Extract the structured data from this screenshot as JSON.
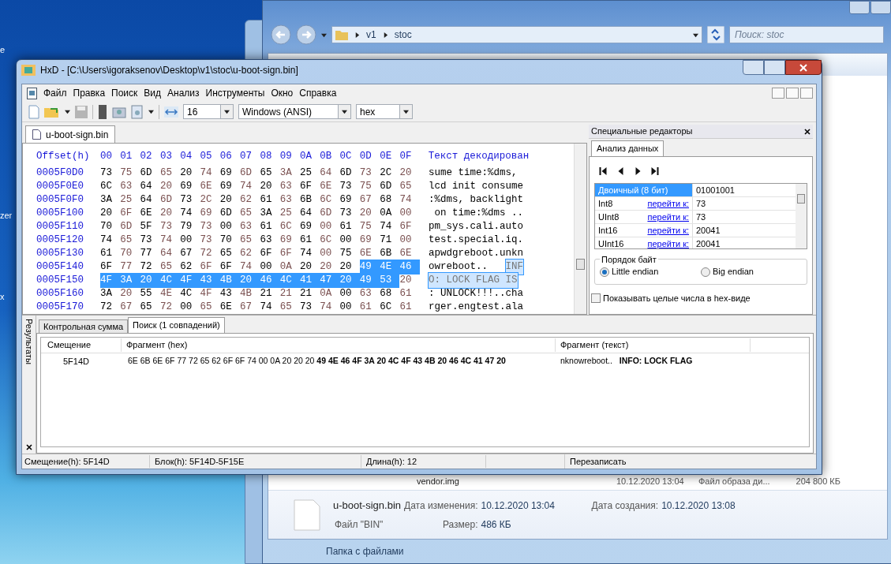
{
  "desktop": {
    "icon_labels": [
      "e",
      "zer",
      "x"
    ]
  },
  "explorer": {
    "breadcrumb": [
      "v1",
      "stoc"
    ],
    "search": {
      "placeholder": "Поиск: stoc"
    },
    "file_row": {
      "name": "vendor.img",
      "date": "10.12.2020 13:04",
      "type": "Файл образа ди...",
      "size": "204 800 КБ"
    },
    "details": {
      "name": "u-boot-sign.bin",
      "type": "Файл \"BIN\"",
      "modified_label": "Дата изменения:",
      "modified": "10.12.2020 13:04",
      "size_label": "Размер:",
      "size": "486 КБ",
      "created_label": "Дата создания:",
      "created": "10.12.2020 13:08"
    },
    "status": "Папка с файлами"
  },
  "hxd": {
    "title": "HxD - [C:\\Users\\igoraksenov\\Desktop\\v1\\stoc\\u-boot-sign.bin]",
    "menu": [
      "Файл",
      "Правка",
      "Поиск",
      "Вид",
      "Анализ",
      "Инструменты",
      "Окно",
      "Справка"
    ],
    "toolbar": {
      "bytes_per_row": "16",
      "charset": "Windows (ANSI)",
      "offset_base": "hex"
    },
    "document_tab": {
      "label": "u-boot-sign.bin",
      "selected": true
    },
    "hex_view": {
      "header": {
        "offset": "Offset(h)",
        "columns": [
          "00",
          "01",
          "02",
          "03",
          "04",
          "05",
          "06",
          "07",
          "08",
          "09",
          "0A",
          "0B",
          "0C",
          "0D",
          "0E",
          "0F"
        ],
        "text": "Текст декодирован"
      },
      "rows": [
        {
          "offset": "0005F0D0",
          "groups": [
            {
              "selected": false,
              "bytes": [
                "73",
                "75",
                "6D",
                "65",
                "20",
                "74",
                "69",
                "6D",
                "65",
                "3A",
                "25",
                "64",
                "6D",
                "73",
                "2C",
                "20"
              ]
            }
          ],
          "text": [
            {
              "selected": false,
              "text": "sume time:%dms,"
            }
          ]
        },
        {
          "offset": "0005F0E0",
          "groups": [
            {
              "selected": false,
              "bytes": [
                "6C",
                "63",
                "64",
                "20",
                "69",
                "6E",
                "69",
                "74",
                "20",
                "63",
                "6F",
                "6E",
                "73",
                "75",
                "6D",
                "65"
              ]
            }
          ],
          "text": [
            {
              "selected": false,
              "text": "lcd init consume"
            }
          ]
        },
        {
          "offset": "0005F0F0",
          "groups": [
            {
              "selected": false,
              "bytes": [
                "3A",
                "25",
                "64",
                "6D",
                "73",
                "2C",
                "20",
                "62",
                "61",
                "63",
                "6B",
                "6C",
                "69",
                "67",
                "68",
                "74"
              ]
            }
          ],
          "text": [
            {
              "selected": false,
              "text": ":%dms, backlight"
            }
          ]
        },
        {
          "offset": "0005F100",
          "groups": [
            {
              "selected": false,
              "bytes": [
                "20",
                "6F",
                "6E",
                "20",
                "74",
                "69",
                "6D",
                "65",
                "3A",
                "25",
                "64",
                "6D",
                "73",
                "20",
                "0A",
                "00"
              ]
            }
          ],
          "text": [
            {
              "selected": false,
              "text": " on time:%dms .."
            }
          ]
        },
        {
          "offset": "0005F110",
          "groups": [
            {
              "selected": false,
              "bytes": [
                "70",
                "6D",
                "5F",
                "73",
                "79",
                "73",
                "00",
                "63",
                "61",
                "6C",
                "69",
                "00",
                "61",
                "75",
                "74",
                "6F"
              ]
            }
          ],
          "text": [
            {
              "selected": false,
              "text": "pm_sys.cali.auto"
            }
          ]
        },
        {
          "offset": "0005F120",
          "groups": [
            {
              "selected": false,
              "bytes": [
                "74",
                "65",
                "73",
                "74",
                "00",
                "73",
                "70",
                "65",
                "63",
                "69",
                "61",
                "6C",
                "00",
                "69",
                "71",
                "00"
              ]
            }
          ],
          "text": [
            {
              "selected": false,
              "text": "test.special.iq."
            }
          ]
        },
        {
          "offset": "0005F130",
          "groups": [
            {
              "selected": false,
              "bytes": [
                "61",
                "70",
                "77",
                "64",
                "67",
                "72",
                "65",
                "62",
                "6F",
                "6F",
                "74",
                "00",
                "75",
                "6E",
                "6B",
                "6E"
              ]
            }
          ],
          "text": [
            {
              "selected": false,
              "text": "apwdgreboot.unkn"
            }
          ]
        },
        {
          "offset": "0005F140",
          "groups": [
            {
              "selected": false,
              "bytes": [
                "6F",
                "77",
                "72",
                "65",
                "62",
                "6F",
                "6F",
                "74",
                "00",
                "0A",
                "20",
                "20",
                "20"
              ]
            },
            {
              "selected": true,
              "bytes": [
                "49",
                "4E",
                "46"
              ]
            }
          ],
          "text": [
            {
              "selected": false,
              "text": "owreboot..   "
            },
            {
              "selected": true,
              "text": "INF"
            }
          ]
        },
        {
          "offset": "0005F150",
          "groups": [
            {
              "selected": true,
              "bytes": [
                "4F",
                "3A",
                "20",
                "4C",
                "4F",
                "43",
                "4B",
                "20",
                "46",
                "4C",
                "41",
                "47",
                "20",
                "49",
                "53"
              ]
            },
            {
              "selected": false,
              "bytes": [
                "20"
              ]
            }
          ],
          "text": [
            {
              "selected": true,
              "text": "O: LOCK FLAG IS"
            }
          ]
        },
        {
          "offset": "0005F160",
          "groups": [
            {
              "selected": false,
              "bytes": [
                "3A",
                "20",
                "55",
                "4E",
                "4C",
                "4F",
                "43",
                "4B",
                "21",
                "21",
                "21",
                "0A",
                "00",
                "63",
                "68",
                "61"
              ]
            }
          ],
          "text": [
            {
              "selected": false,
              "text": ": UNLOCK!!!..cha"
            }
          ]
        },
        {
          "offset": "0005F170",
          "groups": [
            {
              "selected": false,
              "bytes": [
                "72",
                "67",
                "65",
                "72",
                "00",
                "65",
                "6E",
                "67",
                "74",
                "65",
                "73",
                "74",
                "00",
                "61",
                "6C",
                "61"
              ]
            }
          ],
          "text": [
            {
              "selected": false,
              "text": "rger.engtest.ala"
            }
          ]
        }
      ]
    },
    "special_editors": {
      "title": "Специальные редакторы",
      "tab": {
        "label": "Анализ данных",
        "selected": true
      },
      "rows": [
        {
          "type": "Двоичный (8 бит)",
          "selected": true,
          "value": "01001001"
        },
        {
          "type": "Int8",
          "link": "перейти к:",
          "selected": false,
          "value": "73"
        },
        {
          "type": "UInt8",
          "link": "перейти к:",
          "selected": false,
          "value": "73"
        },
        {
          "type": "Int16",
          "link": "перейти к:",
          "selected": false,
          "value": "20041"
        },
        {
          "type": "UInt16",
          "link": "перейти к:",
          "selected": false,
          "value": "20041"
        }
      ],
      "byte_order": {
        "title": "Порядок байт",
        "options": [
          {
            "label": "Little endian",
            "selected": true
          },
          {
            "label": "Big endian",
            "selected": false
          }
        ]
      },
      "hex_ints": {
        "label": "Показывать целые числа в hex-виде",
        "checked": false
      }
    },
    "results": {
      "side_tab": "Результаты",
      "tabs": [
        {
          "label": "Контрольная сумма",
          "selected": false
        },
        {
          "label": "Поиск (1 совпадений)",
          "selected": true
        }
      ],
      "columns": [
        "Смещение",
        "Фрагмент (hex)",
        "Фрагмент (текст)"
      ],
      "rows": [
        {
          "offset": "5F14D",
          "hex": "6E 6B 6E 6F 77 72 65 62 6F 6F 74 00 0A 20 20 20 **49 4E 46 4F 3A 20 4C 4F 43 4B 20 46 4C 41 47 20**",
          "text": "nknowreboot..   **INFO: LOCK FLAG**"
        }
      ]
    },
    "status_bar": [
      "Смещение(h): 5F14D",
      "Блок(h): 5F14D-5F15E",
      "Длина(h): 12",
      "Перезаписать"
    ]
  }
}
